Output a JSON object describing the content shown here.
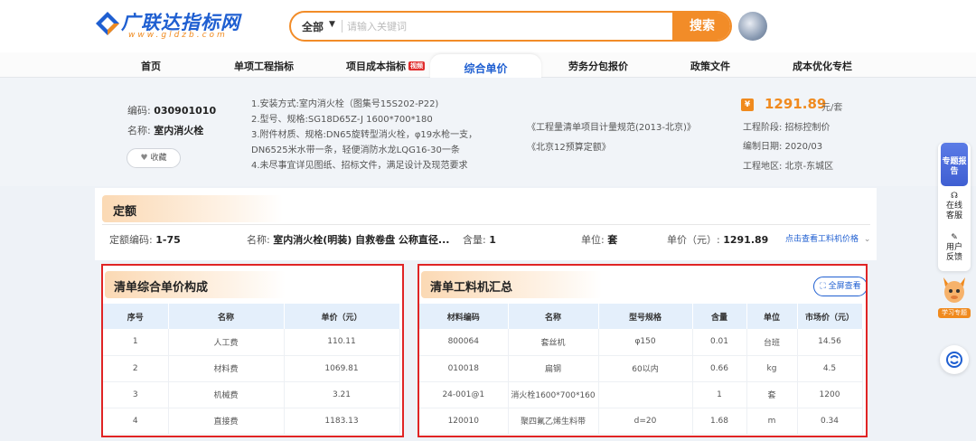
{
  "header": {
    "logo_text": "广联达指标网",
    "logo_sub": "www.gldzb.com",
    "search_scope": "全部",
    "search_placeholder": "请输入关键词",
    "search_button": "搜索"
  },
  "nav": {
    "items": [
      "首页",
      "单项工程指标",
      "项目成本指标",
      "综合单价",
      "劳务分包报价",
      "政策文件",
      "成本优化专栏"
    ],
    "hot_badge": "视频",
    "active": "综合单价"
  },
  "item": {
    "code_label": "编码:",
    "code": "030901010",
    "name_label": "名称:",
    "name": "室内消火栓",
    "favorite": "收藏",
    "description": [
      "1.安装方式:室内消火栓（图集号15S202-P22)",
      "2.型号、规格:SG18D65Z-J 1600*700*180",
      "3.附件材质、规格:DN65旋转型消火栓，φ19水枪一支，DN6525米水带一条，轻便消防水龙LQG16-30一条",
      "4.未尽事宜详见图纸、招标文件，满足设计及现范要求"
    ],
    "norms": [
      "《工程量清单项目计量规范(2013-北京)》",
      "《北京12预算定额》"
    ],
    "price": "1291.89",
    "price_unit": "元/套",
    "stage": "工程阶段: 招标控制价",
    "date": "编制日期: 2020/03",
    "region": "工程地区: 北京-东城区"
  },
  "quota": {
    "title": "定额",
    "code_label": "定额编码:",
    "code": "1-75",
    "name_label": "名称:",
    "name": "室内消火栓(明装) 自救卷盘 公称直径...",
    "qty_label": "含量:",
    "qty": "1",
    "unit_label": "单位:",
    "unit": "套",
    "price_label": "单价（元）:",
    "price": "1291.89",
    "link": "点击查看工料机价格"
  },
  "composition": {
    "title": "清单综合单价构成",
    "headers": [
      "序号",
      "名称",
      "单价（元）"
    ],
    "rows": [
      [
        "1",
        "人工费",
        "110.11"
      ],
      [
        "2",
        "材料费",
        "1069.81"
      ],
      [
        "3",
        "机械费",
        "3.21"
      ],
      [
        "4",
        "直接费",
        "1183.13"
      ]
    ]
  },
  "materials": {
    "title": "清单工料机汇总",
    "fullscreen": "全屏查看",
    "headers": [
      "材料编码",
      "名称",
      "型号规格",
      "含量",
      "单位",
      "市场价（元）"
    ],
    "rows": [
      [
        "800064",
        "套丝机",
        "φ150",
        "0.01",
        "台班",
        "14.56"
      ],
      [
        "010018",
        "扁钢",
        "60以内",
        "0.66",
        "kg",
        "4.5"
      ],
      [
        "24-001@1",
        "消火栓1600*700*160",
        "",
        "1",
        "套",
        "1200"
      ],
      [
        "120010",
        "聚四氟乙烯生料带",
        "d=20",
        "1.68",
        "m",
        "0.34"
      ]
    ]
  },
  "tools": {
    "report": "专题报告",
    "online": "在线客服",
    "feedback": "用户反馈",
    "mascot": "学习专题"
  },
  "colors": {
    "brand_blue": "#1f5fd1",
    "accent_orange": "#f08a1e",
    "highlight_red": "#e02424"
  }
}
